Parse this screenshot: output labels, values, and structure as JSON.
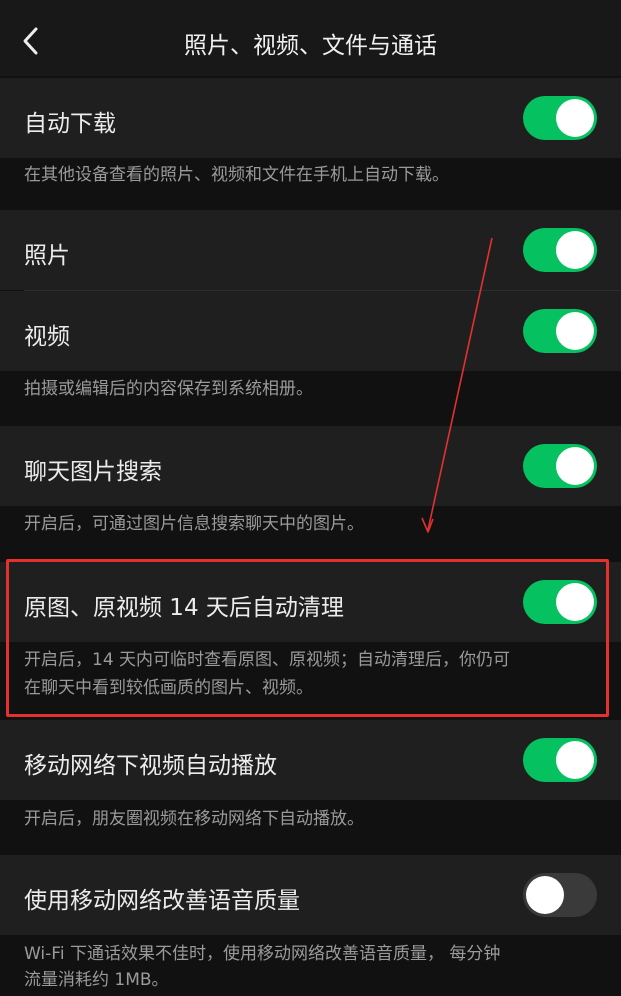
{
  "nav": {
    "title": "照片、视频、文件与通话"
  },
  "settings": {
    "auto_download": {
      "label": "自动下载",
      "enabled": true
    },
    "auto_download_note": "在其他设备查看的照片、视频和文件在手机上自动下载。",
    "photos": {
      "label": "照片",
      "enabled": true
    },
    "videos": {
      "label": "视频",
      "enabled": true
    },
    "save_note": "拍摄或编辑后的内容保存到系统相册。",
    "chat_image_search": {
      "label": "聊天图片搜索",
      "enabled": true
    },
    "chat_image_search_note": "开启后，可通过图片信息搜索聊天中的图片。",
    "auto_cleanup": {
      "label": "原图、原视频 14 天后自动清理",
      "enabled": true
    },
    "auto_cleanup_note_line1": "开启后，14 天内可临时查看原图、原视频；自动清理后，你仍可",
    "auto_cleanup_note_line2": "在聊天中看到较低画质的图片、视频。",
    "mobile_autoplay": {
      "label": "移动网络下视频自动播放",
      "enabled": true
    },
    "mobile_autoplay_note": "开启后，朋友圈视频在移动网络下自动播放。",
    "voice_quality": {
      "label": "使用移动网络改善语音质量",
      "enabled": false
    },
    "voice_quality_note_line1": "Wi-Fi 下通话效果不佳时，使用移动网络改善语音质量， 每分钟",
    "voice_quality_note_line2": "流量消耗约 1MB。"
  },
  "colors": {
    "toggle_on": "#06c160",
    "toggle_off": "#3a3a3a",
    "annotation": "#e53030",
    "row_background": "#1f1f1f",
    "page_background": "#111111"
  }
}
